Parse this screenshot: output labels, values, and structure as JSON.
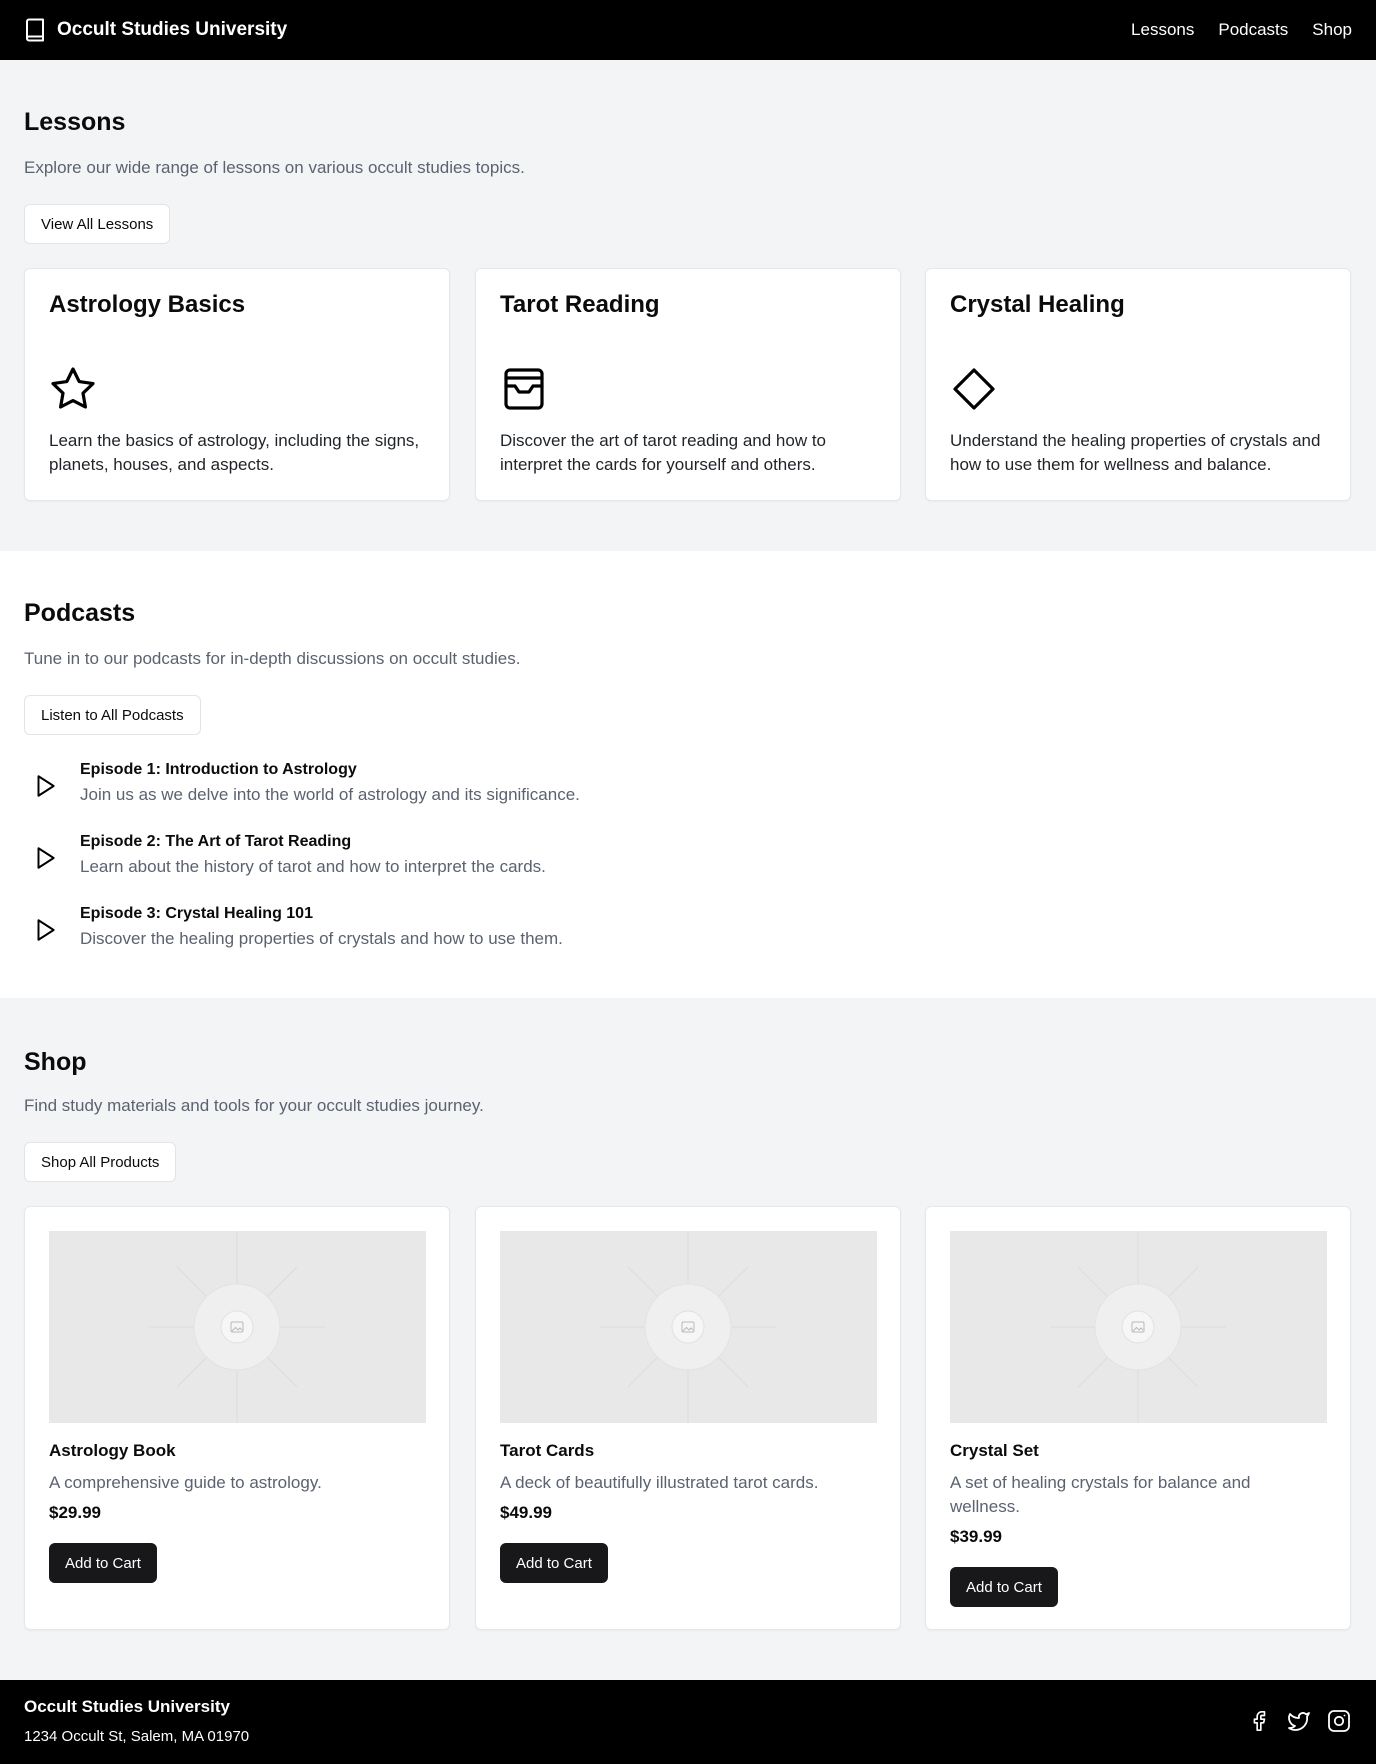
{
  "header": {
    "brand": "Occult Studies University",
    "brand_icon": "book-icon",
    "nav": [
      "Lessons",
      "Podcasts",
      "Shop"
    ]
  },
  "lessons": {
    "title": "Lessons",
    "description": "Explore our wide range of lessons on various occult studies topics.",
    "button": "View All Lessons",
    "cards": [
      {
        "title": "Astrology Basics",
        "icon": "star-icon",
        "text": "Learn the basics of astrology, including the signs, planets, houses, and aspects."
      },
      {
        "title": "Tarot Reading",
        "icon": "tarot-card-icon",
        "text": "Discover the art of tarot reading and how to interpret the cards for yourself and others."
      },
      {
        "title": "Crystal Healing",
        "icon": "crystal-diamond-icon",
        "text": "Understand the healing properties of crystals and how to use them for wellness and balance."
      }
    ]
  },
  "podcasts": {
    "title": "Podcasts",
    "description": "Tune in to our podcasts for in-depth discussions on occult studies.",
    "button": "Listen to All Podcasts",
    "episodes": [
      {
        "title": "Episode 1: Introduction to Astrology",
        "desc": "Join us as we delve into the world of astrology and its significance."
      },
      {
        "title": "Episode 2: The Art of Tarot Reading",
        "desc": "Learn about the history of tarot and how to interpret the cards."
      },
      {
        "title": "Episode 3: Crystal Healing 101",
        "desc": "Discover the healing properties of crystals and how to use them."
      }
    ]
  },
  "shop": {
    "title": "Shop",
    "description": "Find study materials and tools for your occult studies journey.",
    "button": "Shop All Products",
    "products": [
      {
        "name": "Astrology Book",
        "desc": "A comprehensive guide to astrology.",
        "price": "$29.99",
        "button": "Add to Cart"
      },
      {
        "name": "Tarot Cards",
        "desc": "A deck of beautifully illustrated tarot cards.",
        "price": "$49.99",
        "button": "Add to Cart"
      },
      {
        "name": "Crystal Set",
        "desc": "A set of healing crystals for balance and wellness.",
        "price": "$39.99",
        "button": "Add to Cart"
      }
    ]
  },
  "footer": {
    "name": "Occult Studies University",
    "address": "1234 Occult St, Salem, MA 01970",
    "socials": [
      "facebook-icon",
      "twitter-icon",
      "instagram-icon"
    ]
  },
  "colors": {
    "header_bg": "#000000",
    "section_alt_bg": "#f3f4f6",
    "button_dark": "#18181b",
    "muted_text": "#5b6270"
  }
}
